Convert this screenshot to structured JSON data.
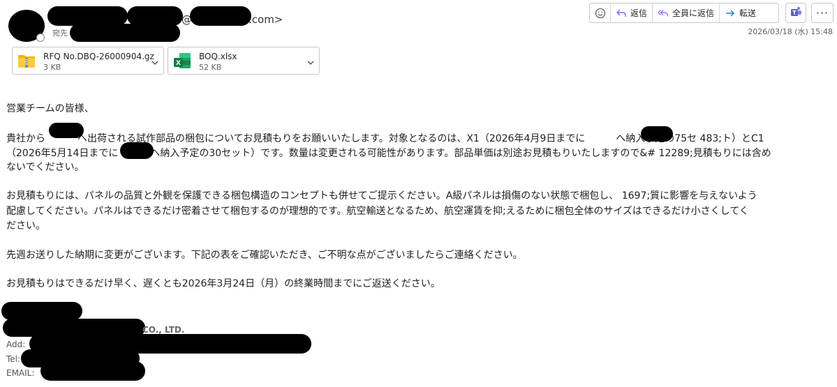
{
  "header": {
    "from_at": "@",
    "from_suffix": ".com>",
    "to_label": "宛先",
    "date": "2026/03/18 (水) 15:48"
  },
  "toolbar": {
    "reply": "返信",
    "reply_all": "全員に返信",
    "forward": "転送",
    "more": "···",
    "emoji_icon": "smiley-icon",
    "teams_icon": "teams-icon"
  },
  "attachments": [
    {
      "name": "RFQ No.DBQ-26000904.gz",
      "size": "3 KB",
      "icon": "zip-folder-icon"
    },
    {
      "name": "BOQ.xlsx",
      "size": "52 KB",
      "icon": "excel-icon"
    }
  ],
  "body": {
    "greeting": "営業チームの皆様、",
    "p1": [
      [
        "貴社から",
        "へ出荷される試作部品の梱包についてお見積もりをお願いいたします。対象となるのは、X1（2026年4月9日までに",
        "へ納入予定の75セ 483;ト）とC1"
      ],
      [
        "（2026年5月14日までに",
        "へ納入予定の30セット）です。数量は変更される可能性があります。部品単価は別途お見積もりいたしますので&# 12289;見積もりには含め"
      ],
      [
        "ないでください。"
      ]
    ],
    "p2": [
      "お見積もりには、パネルの品質と外観を保護できる梱包構造のコンセプトも併せてご提示ください。A級パネルは損傷のない状態で梱包し、 1697;質に影響を与えないよう",
      "配慮してください。パネルはできるだけ密着させて梱包するのが理想的です。航空輸送となるため、航空運賃を抑;えるために梱包全体のサイズはできるだけ小さくしてく",
      "ださい。"
    ],
    "p3": "先週お送りした納期に変更がございます。下記の表をご確認いただき、ご不明な点がございましたらご連絡ください。",
    "p4": "お見積もりはできるだけ早く、遅くとも2026年3月24日（月）の終業時間までにご返送ください。"
  },
  "signature": {
    "company_suffix": "CO., LTD.",
    "add_label": "Add:",
    "tel_label": "Tel:",
    "email_label": "EMAIL:"
  },
  "colors": {
    "accent_purple": "#8b5cf6",
    "forward_blue": "#1a73e8",
    "excel_green": "#107c41",
    "zip_yellow": "#f4b400",
    "teams_purple": "#5b5fc7"
  }
}
